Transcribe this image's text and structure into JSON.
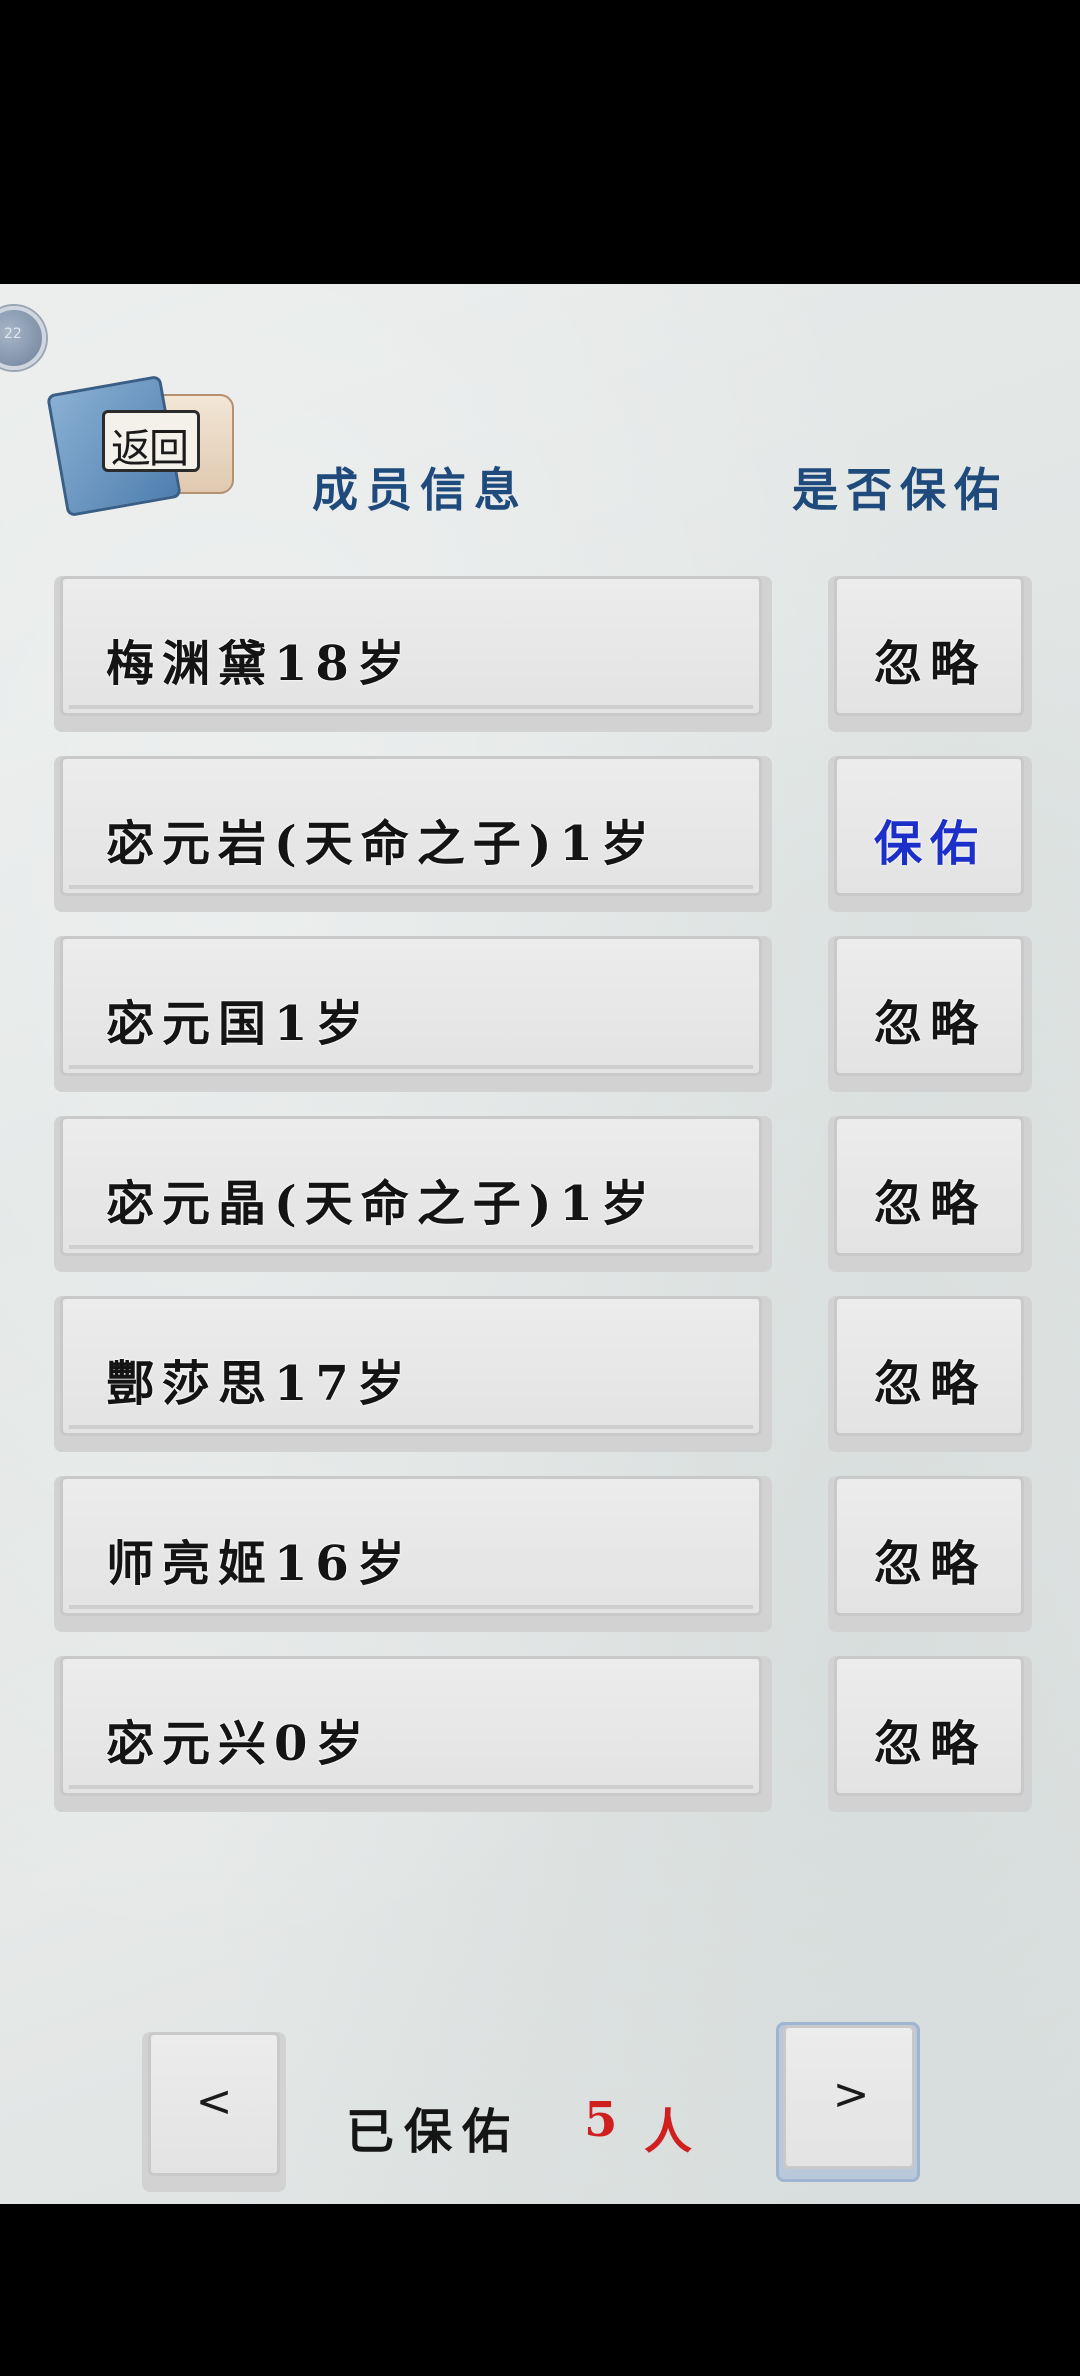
{
  "nav": {
    "back_label": "返回",
    "side_badge": "22"
  },
  "header": {
    "member_info": "成员信息",
    "protect_question": "是否保佑"
  },
  "members": [
    {
      "name": "梅渊黛18岁",
      "action": "忽略"
    },
    {
      "name": "宓元岩(天命之子)1岁",
      "action": "保佑"
    },
    {
      "name": "宓元国1岁",
      "action": "忽略"
    },
    {
      "name": "宓元晶(天命之子)1岁",
      "action": "忽略"
    },
    {
      "name": "酆莎思17岁",
      "action": "忽略"
    },
    {
      "name": "师亮姬16岁",
      "action": "忽略"
    },
    {
      "name": "宓元兴0岁",
      "action": "忽略"
    }
  ],
  "footer": {
    "prev_label": "<",
    "next_label": ">",
    "summary_label": "已保佑",
    "summary_count": "5",
    "summary_unit": "人"
  },
  "colors": {
    "header_text": "#1f4a7c",
    "active_action": "#1d2fc9",
    "count_red": "#cf1f1f"
  }
}
